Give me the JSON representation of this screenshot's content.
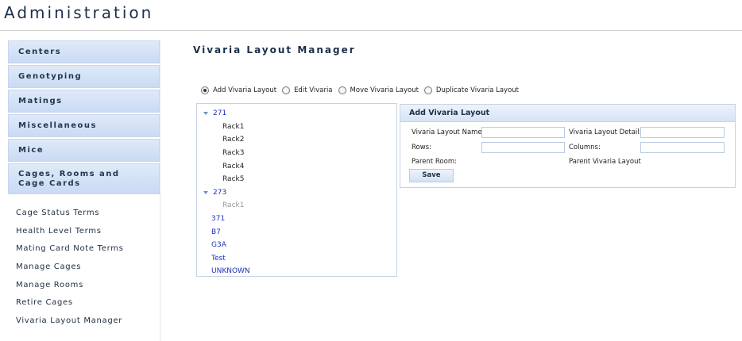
{
  "app": {
    "title": "Administration"
  },
  "sidebar": {
    "sections": [
      {
        "label": "Centers"
      },
      {
        "label": "Genotyping"
      },
      {
        "label": "Matings"
      },
      {
        "label": "Miscellaneous"
      },
      {
        "label": "Mice"
      },
      {
        "label": "Cages, Rooms and Cage Cards"
      }
    ],
    "subitems": [
      {
        "label": "Cage Status Terms"
      },
      {
        "label": "Health Level Terms"
      },
      {
        "label": "Mating Card Note Terms"
      },
      {
        "label": "Manage Cages"
      },
      {
        "label": "Manage Rooms"
      },
      {
        "label": "Retire Cages"
      },
      {
        "label": "Vivaria Layout Manager"
      }
    ]
  },
  "main": {
    "title": "Vivaria Layout Manager",
    "modes": [
      {
        "label": "Add Vivaria Layout",
        "selected": true
      },
      {
        "label": "Edit Vivaria",
        "selected": false
      },
      {
        "label": "Move Vivaria Layout",
        "selected": false
      },
      {
        "label": "Duplicate Vivaria Layout",
        "selected": false
      }
    ],
    "tree": {
      "roots": [
        {
          "label": "271",
          "children": [
            "Rack1",
            "Rack2",
            "Rack3",
            "Rack4",
            "Rack5"
          ]
        },
        {
          "label": "273",
          "children": [
            "Rack1"
          ]
        }
      ],
      "leaves": [
        "371",
        "B7",
        "G3A",
        "Test",
        "UNKNOWN"
      ]
    },
    "form": {
      "header": "Add Vivaria Layout",
      "name_label": "Vivaria Layout Name:",
      "name_value": "",
      "detail_label": "Vivaria Layout Detail:",
      "detail_value": "",
      "rows_label": "Rows:",
      "rows_value": "",
      "columns_label": "Columns:",
      "columns_value": "",
      "parent_room_label": "Parent Room:",
      "parent_layout_label": "Parent Vivaria Layout",
      "save_label": "Save"
    }
  },
  "colors": {
    "accent": "#c9daf4",
    "link": "#1b2fc4",
    "heading": "#1c2f4a"
  }
}
